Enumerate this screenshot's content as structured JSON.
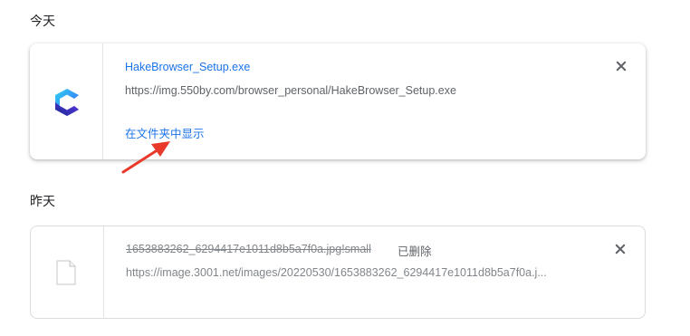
{
  "sections": {
    "today_label": "今天",
    "yesterday_label": "昨天"
  },
  "download1": {
    "filename": "HakeBrowser_Setup.exe",
    "url": "https://img.550by.com/browser_personal/HakeBrowser_Setup.exe",
    "show_in_folder": "在文件夹中显示",
    "icon": "hake-browser-app-icon"
  },
  "download2": {
    "filename": "1653883262_6294417e1011d8b5a7f0a.jpg!small",
    "status": "已删除",
    "url": "https://image.3001.net/images/20220530/1653883262_6294417e1011d8b5a7f0a.j...",
    "icon": "file-icon"
  },
  "colors": {
    "link": "#1a73e8",
    "annotation_arrow": "#e8392a"
  }
}
